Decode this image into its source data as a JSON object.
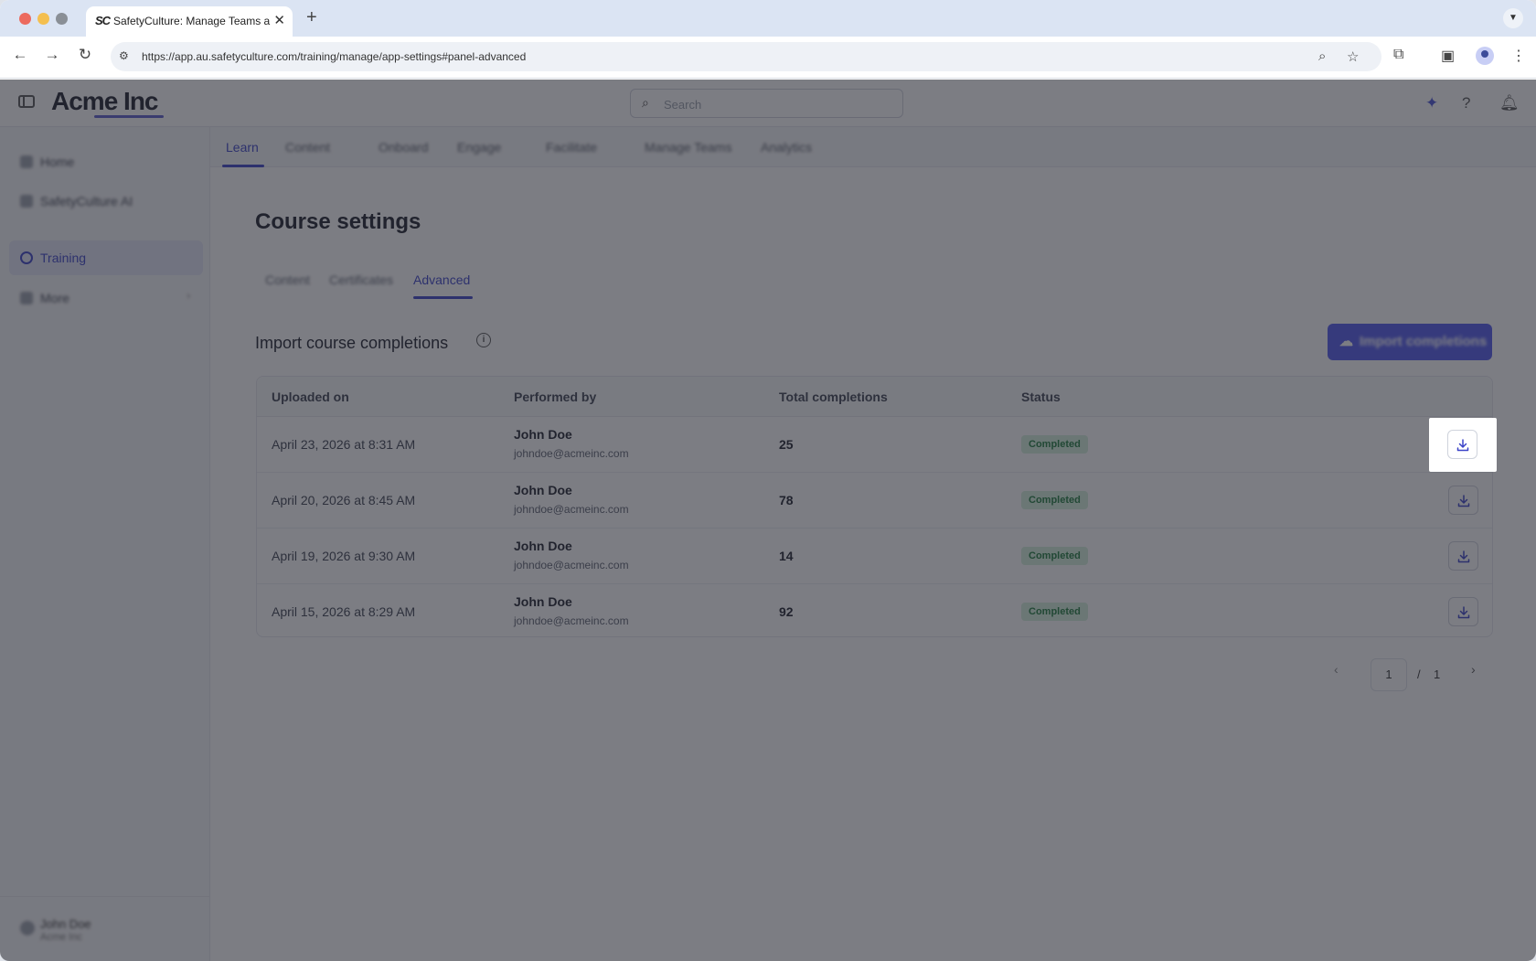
{
  "browser": {
    "tab_favicon": "SC",
    "tab_title": "SafetyCulture: Manage Teams and...",
    "tab_close": "✕",
    "new_tab": "+",
    "url": "https://app.au.safetyculture.com/training/manage/app-settings#panel-advanced"
  },
  "app": {
    "logo": "Acme Inc",
    "search_placeholder": "Search"
  },
  "sidebar": {
    "items": [
      {
        "label": "Home"
      },
      {
        "label": "SafetyCulture AI"
      },
      {
        "label": "Training"
      },
      {
        "label": "More"
      }
    ],
    "user_name": "John Doe",
    "user_org": "Acme Inc"
  },
  "topnav": {
    "items": [
      {
        "label": "Learn"
      },
      {
        "label": "Content"
      },
      {
        "label": "Onboard"
      },
      {
        "label": "Engage"
      },
      {
        "label": "Facilitate"
      },
      {
        "label": "Manage Teams"
      },
      {
        "label": "Analytics"
      }
    ]
  },
  "page": {
    "title": "Course settings",
    "subtabs": [
      {
        "label": "Content"
      },
      {
        "label": "Certificates"
      },
      {
        "label": "Advanced"
      }
    ],
    "section_title": "Import course completions",
    "import_button": "Import completions"
  },
  "table": {
    "headers": [
      "Uploaded on",
      "Performed by",
      "Total completions",
      "Status"
    ],
    "rows": [
      {
        "uploaded": "April 23, 2026 at 8:31 AM",
        "name": "John Doe",
        "email": "johndoe@acmeinc.com",
        "total": "25",
        "status": "Completed"
      },
      {
        "uploaded": "April 20, 2026 at 8:45 AM",
        "name": "John Doe",
        "email": "johndoe@acmeinc.com",
        "total": "78",
        "status": "Completed"
      },
      {
        "uploaded": "April 19, 2026 at 9:30 AM",
        "name": "John Doe",
        "email": "johndoe@acmeinc.com",
        "total": "14",
        "status": "Completed"
      },
      {
        "uploaded": "April 15, 2026 at 8:29 AM",
        "name": "John Doe",
        "email": "johndoe@acmeinc.com",
        "total": "92",
        "status": "Completed"
      }
    ]
  },
  "pagination": {
    "current": "1",
    "separator": "/",
    "total": "1"
  },
  "colors": {
    "accent": "#3b43c8",
    "button": "#5159ee",
    "status_completed": "#d4f0dc"
  }
}
